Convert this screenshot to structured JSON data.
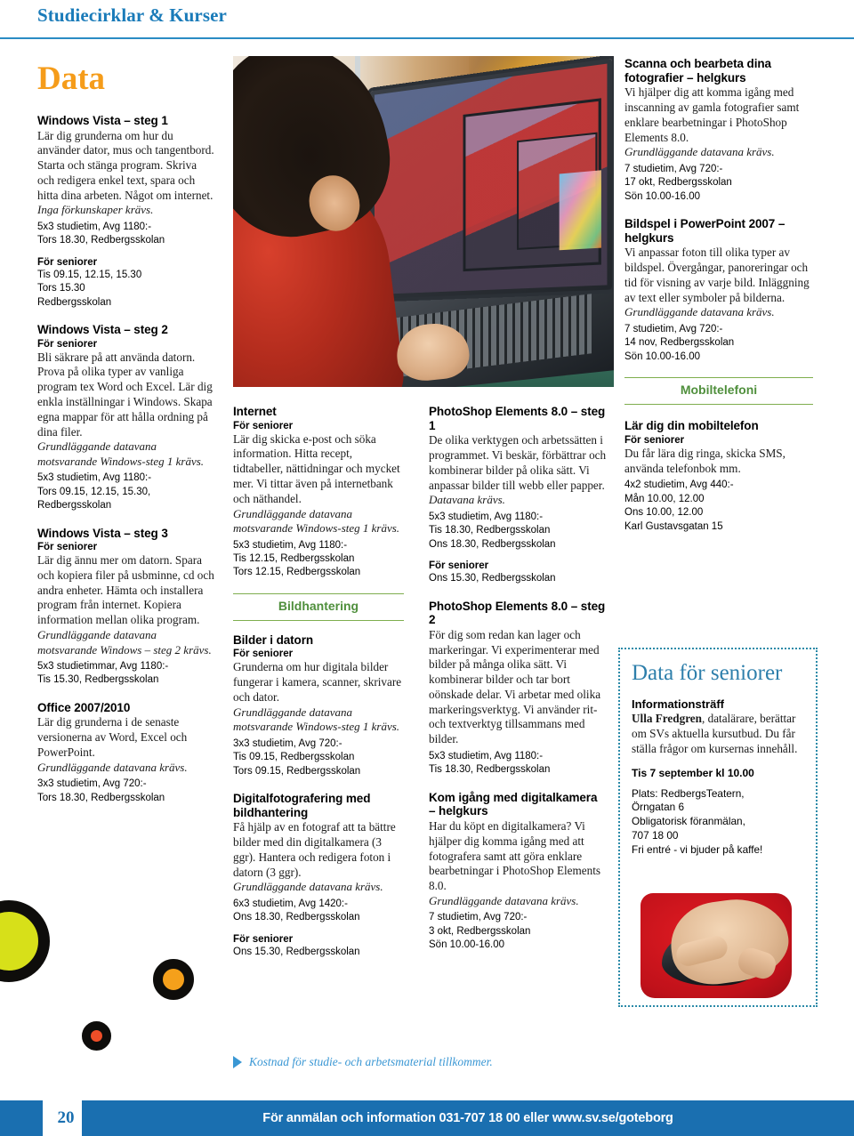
{
  "header": {
    "title": "Studiecirklar & Kurser"
  },
  "section": {
    "title": "Data"
  },
  "colors": {
    "brand_blue": "#1a7bb9",
    "accent_orange": "#f59c1a",
    "category_green": "#4f8f3c",
    "dotted_border_teal": "#2b8aa8",
    "footer_blue": "#1a6fb0",
    "deco_yellow": "#d7e019",
    "deco_orange": "#f5a01b",
    "deco_red": "#ef4e28"
  },
  "photo": {
    "name": "woman-at-laptop-recursive-photo",
    "alt": "Kvinna framför bärbar dator med rekursiv skärmbild"
  },
  "column1": [
    {
      "title": "Windows Vista – steg 1",
      "body": "Lär dig grunderna om hur du använder dator, mus och tangentbord. Starta och stänga program. Skriva och redigera enkel text, spara och hitta dina arbeten. Något om internet.",
      "requirement": "Inga förkunskaper krävs.",
      "info": [
        "5x3 studietim, Avg 1180:-",
        "Tors 18.30, Redbergsskolan"
      ],
      "group_label": "För seniorer",
      "group_info": [
        "Tis 09.15, 12.15, 15.30",
        "Tors 15.30",
        "Redbergsskolan"
      ]
    },
    {
      "title": "Windows Vista – steg 2",
      "subtitle": "För seniorer",
      "body": "Bli säkrare på att använda datorn. Prova på olika typer av vanliga program tex Word och Excel. Lär dig enkla inställningar i Windows. Skapa egna mappar för att hålla ordning på dina filer.",
      "requirement": "Grundläggande datavana motsvarande Windows-steg 1 krävs.",
      "info": [
        "5x3 studietim, Avg 1180:-",
        "Tors 09.15, 12.15, 15.30,",
        "Redbergsskolan"
      ]
    },
    {
      "title": "Windows Vista – steg 3",
      "subtitle": "För seniorer",
      "body": "Lär dig ännu mer om datorn. Spara och kopiera filer på usbminne, cd och andra enheter. Hämta och installera program från internet. Kopiera information mellan olika program.",
      "requirement": "Grundläggande datavana motsvarande Windows – steg 2 krävs.",
      "info": [
        "5x3 studietimmar, Avg 1180:-",
        "Tis 15.30, Redbergsskolan"
      ]
    },
    {
      "title": "Office 2007/2010",
      "body": "Lär dig grunderna i de senaste versionerna av Word, Excel och PowerPoint.",
      "requirement": "Grundläggande datavana krävs.",
      "info": [
        "3x3 studietim, Avg 720:-",
        "Tors 18.30, Redbergsskolan"
      ]
    }
  ],
  "column2": {
    "courses_top": [
      {
        "title": "Internet",
        "subtitle": "För seniorer",
        "body": "Lär dig skicka e-post och söka information. Hitta recept, tidtabeller, nättidningar och mycket mer. Vi tittar även på internetbank och näthandel.",
        "requirement": "Grundläggande datavana motsvarande Windows-steg 1 krävs.",
        "info": [
          "5x3 studietim, Avg 1180:-",
          "Tis 12.15, Redbergsskolan",
          "Tors 12.15, Redbergsskolan"
        ]
      }
    ],
    "category": "Bildhantering",
    "courses_bottom": [
      {
        "title": "Bilder i datorn",
        "subtitle": "För seniorer",
        "body": "Grunderna om hur digitala bilder fungerar i kamera, scanner, skrivare och dator.",
        "requirement": "Grundläggande datavana motsvarande Windows-steg 1 krävs.",
        "info": [
          "3x3 studietim, Avg 720:-",
          "Tis 09.15, Redbergsskolan",
          "Tors 09.15, Redbergsskolan"
        ]
      },
      {
        "title": "Digitalfotografering med bildhantering",
        "body": "Få hjälp av en fotograf att ta bättre bilder med din digitalkamera (3 ggr). Hantera och redigera foton i datorn (3 ggr).",
        "requirement": "Grundläggande datavana krävs.",
        "info": [
          "6x3 studietim, Avg 1420:-",
          "Ons 18.30, Redbergsskolan"
        ],
        "group_label": "För seniorer",
        "group_info": [
          "Ons 15.30, Redbergsskolan"
        ]
      }
    ]
  },
  "column3": [
    {
      "title": "PhotoShop Elements 8.0 – steg 1",
      "body": "De olika verktygen och arbetssätten i programmet. Vi beskär, förbättrar och kombinerar bilder på olika sätt. Vi anpassar bilder till webb eller papper.",
      "requirement": "Datavana krävs.",
      "info": [
        "5x3 studietim, Avg 1180:-",
        "Tis 18.30, Redbergsskolan",
        "Ons 18.30, Redbergsskolan"
      ],
      "group_label": "För seniorer",
      "group_info": [
        "Ons 15.30, Redbergsskolan"
      ]
    },
    {
      "title": "PhotoShop Elements 8.0 – steg 2",
      "body": "För dig som redan kan lager och markeringar. Vi experimenterar med bilder på många olika sätt. Vi kombinerar bilder och tar bort oönskade delar. Vi arbetar med olika markeringsverktyg. Vi använder rit- och textverktyg tillsammans med bilder.",
      "info": [
        "5x3 studietim, Avg 1180:-",
        "Tis 18.30, Redbergsskolan"
      ]
    },
    {
      "title": "Kom igång med digitalkamera – helgkurs",
      "body": "Har du köpt en digitalkamera? Vi hjälper dig komma igång med att fotografera samt att göra enklare bearbetningar i PhotoShop Elements 8.0.",
      "requirement": "Grundläggande datavana krävs.",
      "info": [
        "7 studietim, Avg 720:-",
        "3 okt, Redbergsskolan",
        "Sön 10.00-16.00"
      ]
    }
  ],
  "column4": {
    "courses_top": [
      {
        "title": "Scanna och bearbeta dina fotografier – helgkurs",
        "body": "Vi hjälper dig att komma igång med inscanning av gamla fotografier samt enklare bearbetningar i PhotoShop Elements 8.0.",
        "requirement": "Grundläggande datavana krävs.",
        "info": [
          "7 studietim, Avg 720:-",
          "17 okt, Redbergsskolan",
          "Sön 10.00-16.00"
        ]
      },
      {
        "title": "Bildspel i PowerPoint 2007 – helgkurs",
        "body": "Vi anpassar foton till olika typer av bildspel. Övergångar, panoreringar och tid för visning av varje bild. Inläggning av text eller symboler på bilderna.",
        "requirement": "Grundläggande datavana krävs.",
        "info": [
          "7 studietim, Avg 720:-",
          "14 nov, Redbergsskolan",
          "Sön 10.00-16.00"
        ]
      }
    ],
    "category": "Mobiltelefoni",
    "courses_bottom": [
      {
        "title": "Lär dig din mobiltelefon",
        "subtitle": "För seniorer",
        "body": "Du får lära dig ringa, skicka SMS, använda telefonbok mm.",
        "info": [
          "4x2 studietim, Avg 440:-",
          "Mån 10.00, 12.00",
          "Ons 10.00, 12.00",
          "Karl Gustavsgatan 15"
        ]
      }
    ]
  },
  "seniorbox": {
    "title": "Data för seniorer",
    "heading": "Informationsträff",
    "lecturer": "Ulla Fredgren",
    "body": ", datalärare, berättar om SVs aktuella kursutbud. Du får ställa frågor om kursernas innehåll.",
    "when": "Tis 7 september kl 10.00",
    "info": [
      "Plats: RedbergsTeatern,",
      "Örngatan 6",
      "Obligatorisk föranmälan,",
      "707 18 00",
      "Fri entré - vi bjuder på kaffe!"
    ],
    "photo_name": "hand-on-computer-mouse"
  },
  "footnote": {
    "text": "Kostnad för studie- och arbetsmaterial tillkommer."
  },
  "footer": {
    "page_number": "20",
    "text": "För anmälan och information 031-707 18 00 eller www.sv.se/goteborg"
  }
}
